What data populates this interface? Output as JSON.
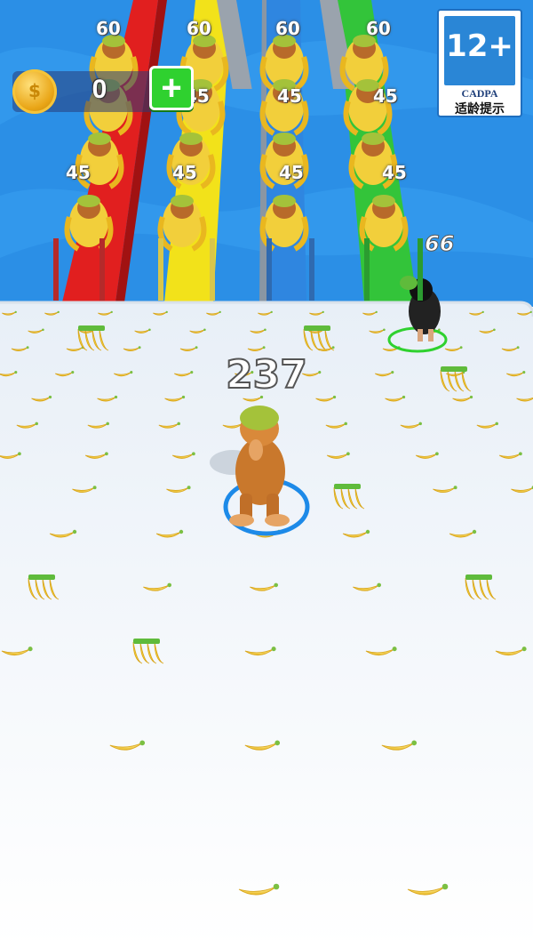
{
  "hud": {
    "coin_icon": "coin-icon",
    "coin_glyph": "$",
    "coins": "0",
    "add_icon": "plus-icon",
    "add_label": "+"
  },
  "age_rating": {
    "rating": "12+",
    "org": "CADPA",
    "note": "适龄提示"
  },
  "player": {
    "score": "237"
  },
  "rival": {
    "score": "66"
  },
  "lanes": [
    {
      "color": "#e11f1f",
      "top_label": "60",
      "mid_label": "45",
      "bottom_label": "45"
    },
    {
      "color": "#f2e21a",
      "top_label": "60",
      "mid_label": "45",
      "bottom_label": "45"
    },
    {
      "color": "#2f86e0",
      "top_label": "60",
      "mid_label": "45",
      "bottom_label": "45"
    },
    {
      "color": "#33c43a",
      "top_label": "60",
      "mid_label": "45",
      "bottom_label": "45"
    }
  ],
  "colors": {
    "water": "#2b8fe6",
    "floor": "#f4f7fb",
    "banana": "#f2cf3b",
    "player_ring": "#1d8ae8",
    "rival_ring": "#2fd12f"
  }
}
